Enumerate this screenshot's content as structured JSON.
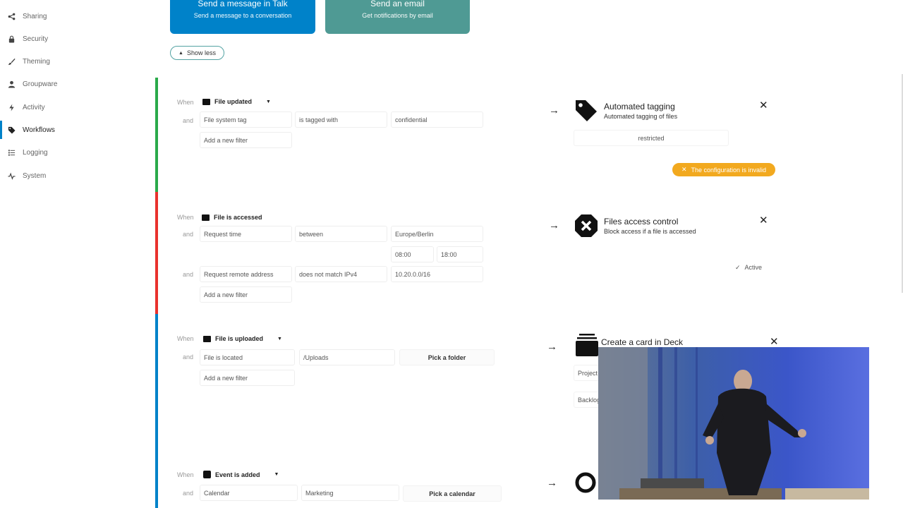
{
  "sidebar": {
    "items": [
      {
        "label": "Sharing",
        "icon": "share-icon"
      },
      {
        "label": "Security",
        "icon": "lock-icon"
      },
      {
        "label": "Theming",
        "icon": "brush-icon"
      },
      {
        "label": "Groupware",
        "icon": "user-icon"
      },
      {
        "label": "Activity",
        "icon": "lightning-icon"
      },
      {
        "label": "Workflows",
        "icon": "tag-icon",
        "active": true
      },
      {
        "label": "Logging",
        "icon": "list-icon"
      },
      {
        "label": "System",
        "icon": "pulse-icon"
      }
    ]
  },
  "top_actions": {
    "talk": {
      "title": "Send a message in Talk",
      "subtitle": "Send a message to a conversation",
      "color": "#0082c9"
    },
    "email": {
      "title": "Send an email",
      "subtitle": "Get notifications by email",
      "color": "#4f9a94"
    },
    "show_less": "Show less"
  },
  "labels": {
    "when": "When",
    "and": "and",
    "add_filter": "Add a new filter"
  },
  "rules": [
    {
      "color": "#2aaa4a",
      "event": "File updated",
      "checks": [
        {
          "a": "File system tag",
          "b": "is tagged with",
          "c": "confidential"
        }
      ],
      "operation": {
        "title": "Automated tagging",
        "description": "Automated tagging of files",
        "value": "restricted"
      },
      "status": "The configuration is invalid"
    },
    {
      "color": "#e9322d",
      "event": "File is accessed",
      "checks": [
        {
          "a": "Request time",
          "b": "between",
          "c": "Europe/Berlin",
          "from": "08:00",
          "to": "18:00"
        },
        {
          "a": "Request remote address",
          "b": "does not match IPv4",
          "c": "10.20.0.0/16"
        }
      ],
      "operation": {
        "title": "Files access control",
        "description": "Block access if a file is accessed"
      },
      "status": "Active"
    },
    {
      "color": "#0082c9",
      "event": "File is uploaded",
      "checks": [
        {
          "a": "File is located",
          "b": "/Uploads",
          "button": "Pick a folder"
        }
      ],
      "operation": {
        "title": "Create a card in Deck",
        "field1": "Project",
        "field2": "Backlog"
      }
    },
    {
      "color": "#0082c9",
      "event": "Event is added",
      "checks": [
        {
          "a": "Calendar",
          "b": "Marketing",
          "button": "Pick a calendar"
        }
      ]
    }
  ],
  "colors": {
    "accent": "#0082c9",
    "warning": "#f2a91f"
  }
}
